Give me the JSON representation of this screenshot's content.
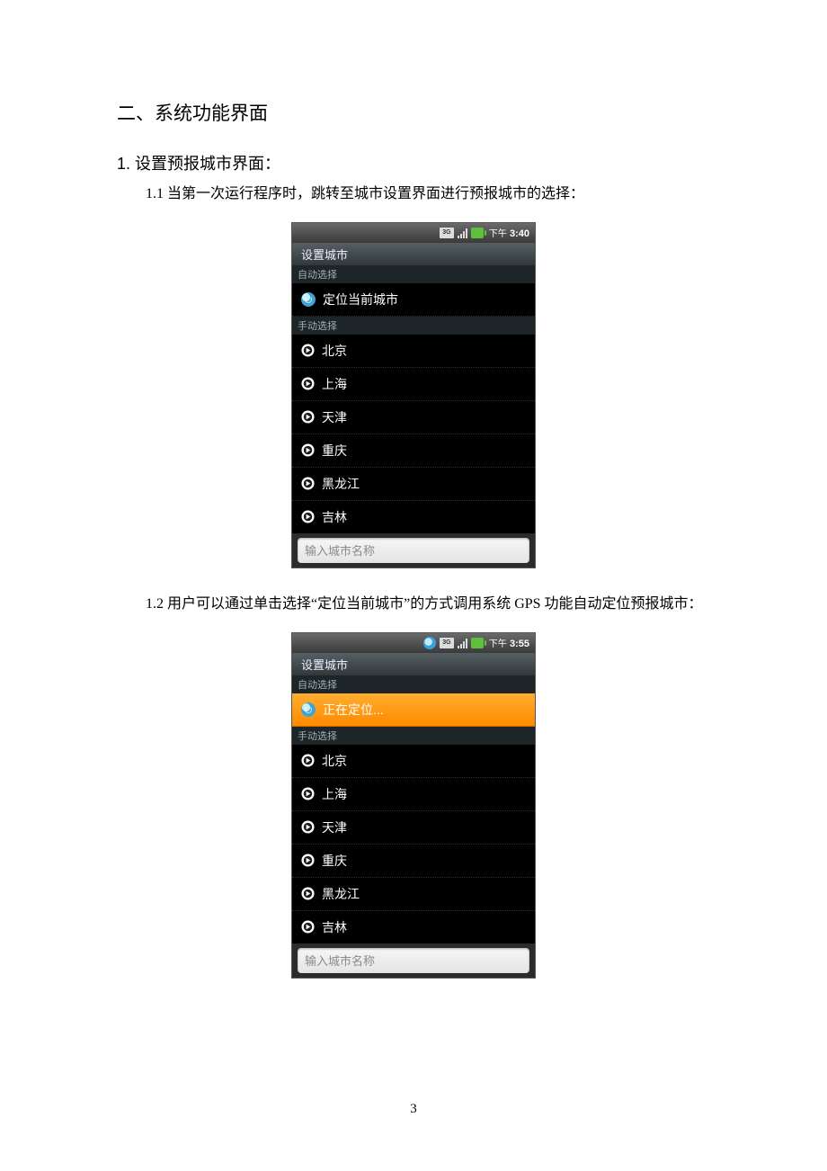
{
  "document": {
    "section_title": "二、系统功能界面",
    "sub1_heading": "1.  设置预报城市界面：",
    "sub11_text": "1.1 当第一次运行程序时，跳转至城市设置界面进行预报城市的选择：",
    "sub12_text": "1.2 用户可以通过单击选择“定位当前城市”的方式调用系统 GPS 功能自动定位预报城市：",
    "page_number": "3"
  },
  "status": {
    "ampm": "下午",
    "time1": "3:40",
    "time2": "3:55"
  },
  "phone_common": {
    "title": "设置城市",
    "auto_label": "自动选择",
    "manual_label": "手动选择",
    "input_placeholder": "输入城市名称"
  },
  "phone1": {
    "locate_label": "定位当前城市",
    "cities": [
      "北京",
      "上海",
      "天津",
      "重庆",
      "黑龙江",
      "吉林"
    ]
  },
  "phone2": {
    "locate_label": "正在定位...",
    "cities": [
      "北京",
      "上海",
      "天津",
      "重庆",
      "黑龙江",
      "吉林"
    ]
  }
}
